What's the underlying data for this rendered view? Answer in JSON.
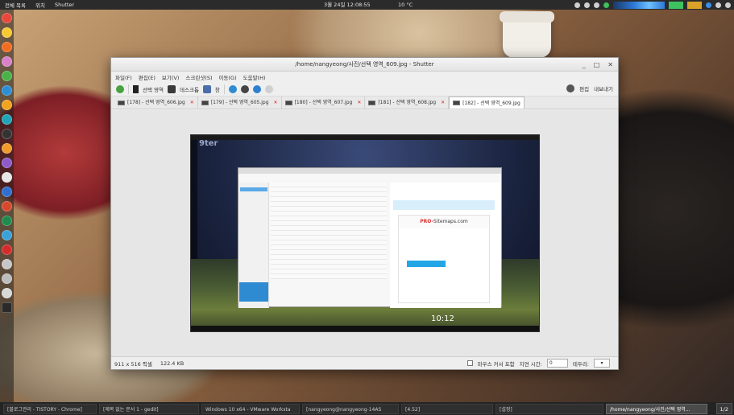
{
  "top_panel": {
    "menu": "전체 목록",
    "places": "위치",
    "app": "Shutter",
    "clock": "3월 24일 12:08:55",
    "temp": "10 °C"
  },
  "window": {
    "title": "/home/nangyeong/사진/선택 영역_609.jpg - Shutter",
    "controls": [
      "_",
      "□",
      "✕"
    ]
  },
  "menubar": [
    "파일(F)",
    "편집(E)",
    "보기(V)",
    "스크린샷(S)",
    "이동(G)",
    "도움말(H)"
  ],
  "toolbar": {
    "select_label": "선택 영역",
    "desktop_label": "데스크톱",
    "window_label": "창",
    "upload_label": "업로드",
    "export_label": "내보내기",
    "edit_label": "편집"
  },
  "tabs": [
    {
      "label": "[178] - 선택 영역_606.jpg"
    },
    {
      "label": "[179] - 선택 영역_605.jpg"
    },
    {
      "label": "[180] - 선택 영역_607.jpg"
    },
    {
      "label": "[181] - 선택 영역_608.jpg"
    },
    {
      "label": "[182] - 선택 영역_609.jpg"
    }
  ],
  "statusbar": {
    "dims": "911 x 516 픽셀",
    "size": "122.4 KB",
    "mouse_label": "마우스 커서 포함",
    "delay_label": "지연 시간:",
    "delay_value": "0",
    "border_label": "테두리:",
    "border_value": "▾"
  },
  "preview": {
    "logo": "9ter",
    "clock": "10:12",
    "brand_pre": "PRO-",
    "brand": "Sitemaps.com"
  },
  "taskbar": [
    {
      "label": "[블로그관리 - TISTORY - Chrome]",
      "active": false
    },
    {
      "label": "[제목 없는 문서 1 - gedit]",
      "active": false
    },
    {
      "label": "Windows 10 x64 - VMware Worksta",
      "active": false
    },
    {
      "label": "[nangyeong@nangyeong-14AS",
      "active": false
    },
    {
      "label": "[4.52]",
      "active": false
    },
    {
      "label": "[설정]",
      "active": false
    },
    {
      "label": "/home/nangyeong/사진/선택 영역...",
      "active": true
    }
  ],
  "page_indicator": "1/2"
}
